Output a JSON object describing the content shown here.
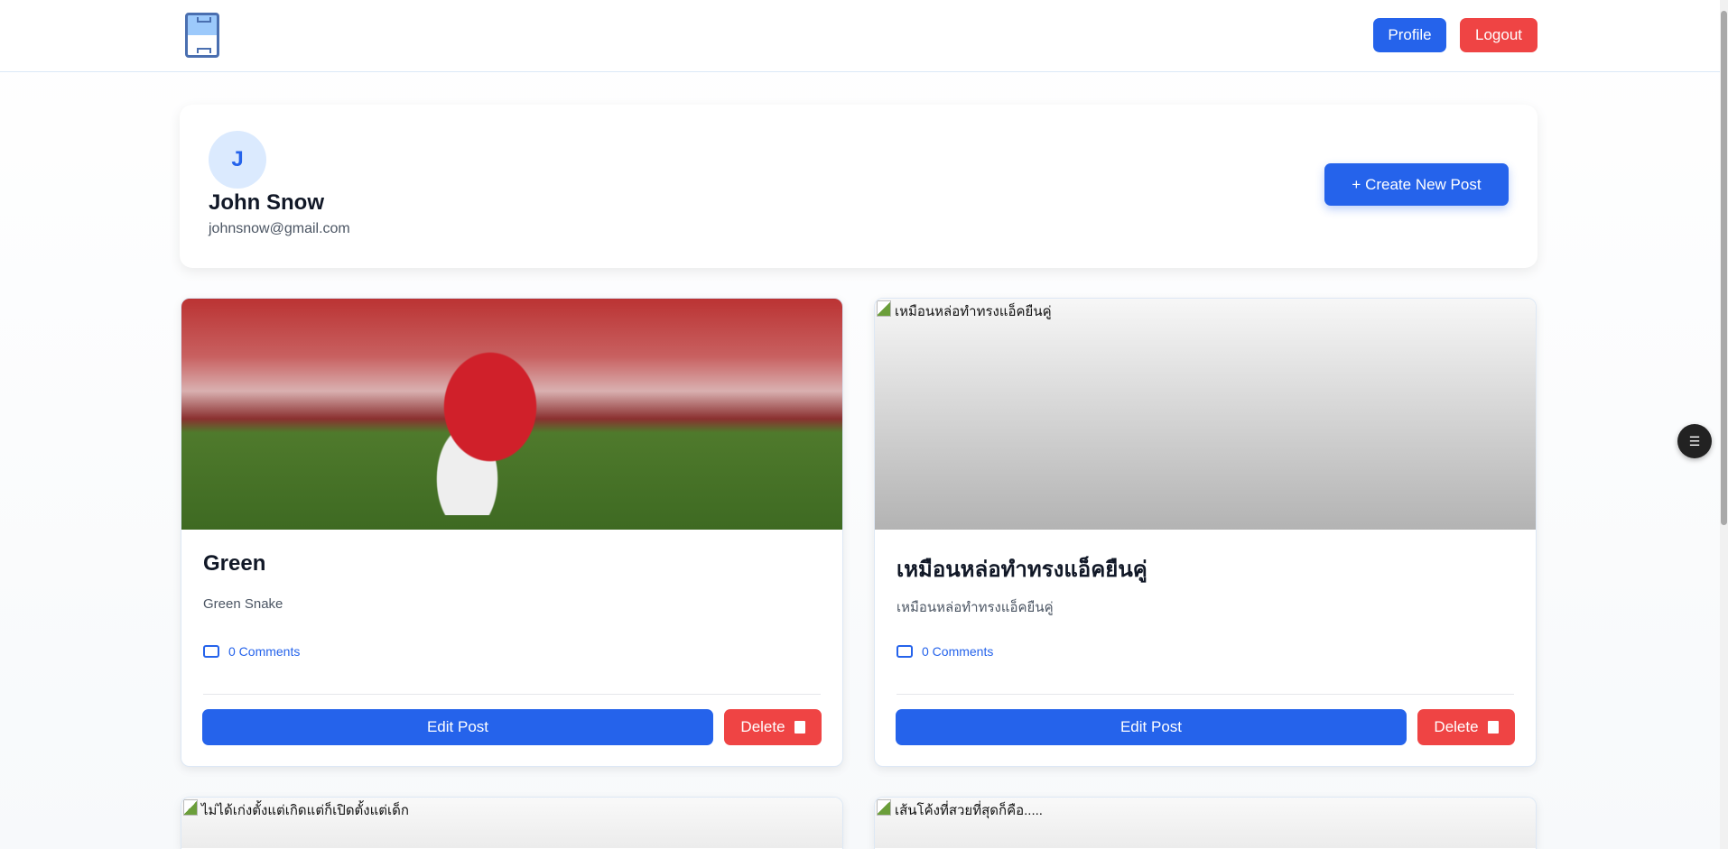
{
  "nav": {
    "logo": "football-field-logo",
    "profile_label": "Profile",
    "logout_label": "Logout"
  },
  "user": {
    "initial": "J",
    "name": "John Snow",
    "email": "johnsnow@gmail.com",
    "create_label": "+ Create New Post"
  },
  "posts": [
    {
      "title": "Green",
      "description": "Green Snake",
      "comments": "0 Comments",
      "image_alt": "",
      "edit": "Edit Post",
      "delete": "Delete"
    },
    {
      "title": "เหมือนหล่อทำทรงแอ็คยืนคู่",
      "description": "เหมือนหล่อทำทรงแอ็คยืนคู่",
      "comments": "0 Comments",
      "image_alt": "เหมือนหล่อทำทรงแอ็คยืนคู่",
      "edit": "Edit Post",
      "delete": "Delete"
    },
    {
      "image_alt": "ไม่ได้เก่งตั้งแต่เกิดแต่ก็เปิดตั้งแต่เด็ก"
    },
    {
      "image_alt": "เส้นโค้งที่สวยที่สุดก็คือ....."
    }
  ],
  "colors": {
    "primary": "#2563eb",
    "danger": "#ef4444"
  }
}
